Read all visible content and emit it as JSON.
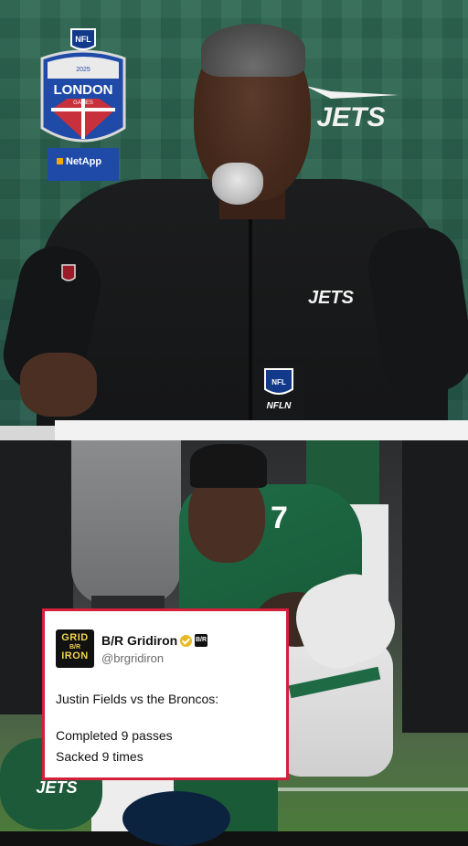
{
  "press_panel": {
    "badge": {
      "brand_mark": "NFL",
      "year": "2025",
      "title": "LONDON",
      "subtitle": "GAMES",
      "sponsor": "NetApp"
    },
    "wall_logo": "JETS",
    "chest_logo": "JETS",
    "mic_flag": {
      "shield": "NFL",
      "network": "NFLN"
    }
  },
  "game_photo": {
    "jersey_number": "7",
    "helmet_logo": "JETS"
  },
  "tweet": {
    "account_name": "B/R Gridiron",
    "badge_text": "B/R",
    "handle": "@brgridiron",
    "avatar_text": {
      "line1": "GRID",
      "middle": "B/R",
      "line2": "IRON"
    },
    "lines": [
      "Justin Fields vs the Broncos:",
      "Completed 9 passes",
      "Sacked 9 times"
    ]
  },
  "colors": {
    "jets_green": "#1f6b45",
    "tweet_border": "#d4203b",
    "wall_green": "#2f6a55",
    "verified_gold": "#e8b923"
  }
}
